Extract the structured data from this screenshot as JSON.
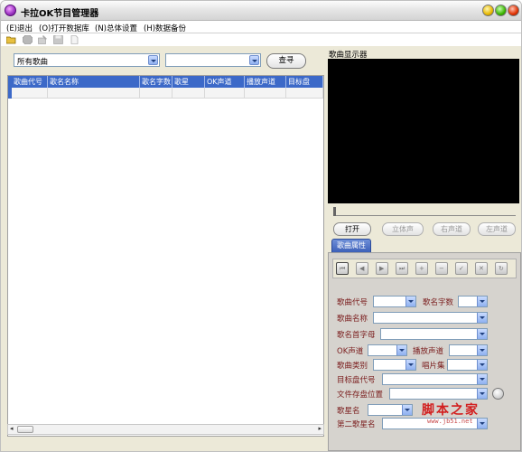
{
  "window": {
    "title": "卡拉OK节目管理器"
  },
  "menu": [
    "(E)退出",
    "(O)打开数据库",
    "(N)总体设置",
    "(H)数据备份"
  ],
  "toolbar": {
    "icons": [
      "open-folder-icon",
      "stop-icon",
      "edit-icon",
      "save-icon",
      "new-doc-icon"
    ]
  },
  "filter": {
    "category_value": "所有歌曲",
    "search_value": "",
    "search_button": "查寻"
  },
  "grid": {
    "columns": [
      "歌曲代号",
      "歌名名称",
      "歌名字数",
      "歌星",
      "OK声道",
      "播放声道",
      "目标盘"
    ]
  },
  "player": {
    "display_label": "歌曲显示器",
    "buttons": [
      "打开",
      "立体声",
      "右声道",
      "左声道"
    ]
  },
  "tab": {
    "label": "歌曲属性"
  },
  "form": {
    "song_code": "歌曲代号",
    "name_length": "歌名字数",
    "song_name": "歌曲名称",
    "initials": "歌名首字母",
    "ok_channel": "OK声道",
    "play_channel": "播放声道",
    "category": "歌曲类别",
    "album": "唱片集",
    "target_disk_code": "目标盘代号",
    "file_location": "文件存盘位置",
    "singer_name": "歌星名",
    "second_singer_name": "第二歌星名"
  },
  "watermark": {
    "text": "脚本之家",
    "url": "www.jb51.net"
  },
  "colors": {
    "header_blue": "#3c69c8",
    "label_red": "#7a1c1c",
    "video_bg": "#000000"
  }
}
